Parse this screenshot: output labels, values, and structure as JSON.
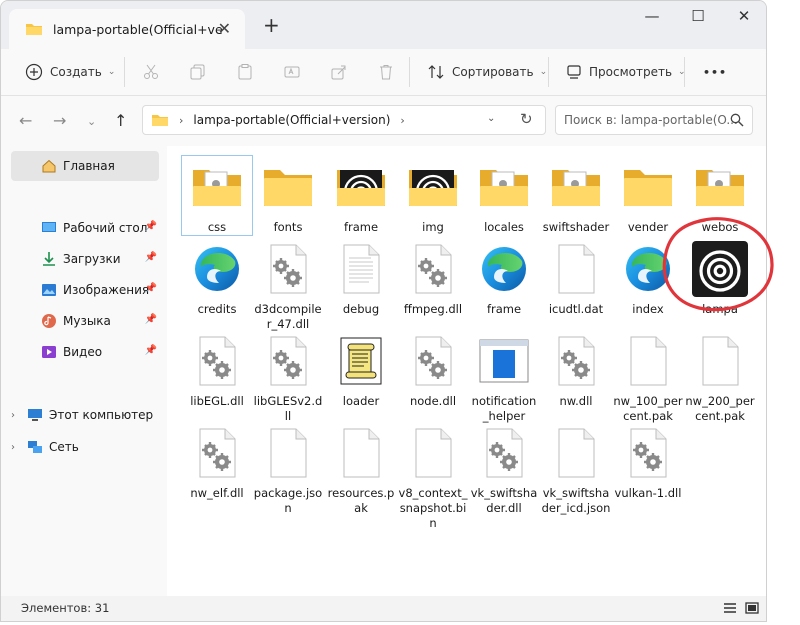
{
  "tab": {
    "title": "lampa-portable(Official+versi",
    "close": "✕",
    "new": "+"
  },
  "window_controls": {
    "minimize": "—",
    "maximize": "☐",
    "close": "✕"
  },
  "toolbar": {
    "create": "Создать",
    "sort": "Сортировать",
    "view": "Просмотреть",
    "more": "•••"
  },
  "address": {
    "crumb": "lampa-portable(Official+version)",
    "search_placeholder": "Поиск в: lampa-portable(O..."
  },
  "sidebar": {
    "home": "Главная",
    "pinned": [
      "Рабочий стол",
      "Загрузки",
      "Изображения",
      "Музыка",
      "Видео"
    ],
    "this_pc": "Этот компьютер",
    "network": "Сеть"
  },
  "files": [
    {
      "label": "css",
      "type": "folder-doc"
    },
    {
      "label": "fonts",
      "type": "folder"
    },
    {
      "label": "frame",
      "type": "folder-lampa"
    },
    {
      "label": "img",
      "type": "folder-lampa"
    },
    {
      "label": "locales",
      "type": "folder-doc"
    },
    {
      "label": "swiftshader",
      "type": "folder-doc"
    },
    {
      "label": "vender",
      "type": "folder"
    },
    {
      "label": "webos",
      "type": "folder-doc"
    },
    {
      "label": "credits",
      "type": "edge"
    },
    {
      "label": "d3dcompiler_47.dll",
      "type": "dll"
    },
    {
      "label": "debug",
      "type": "textdoc"
    },
    {
      "label": "ffmpeg.dll",
      "type": "dll"
    },
    {
      "label": "frame",
      "type": "edge"
    },
    {
      "label": "icudtl.dat",
      "type": "blank"
    },
    {
      "label": "index",
      "type": "edge"
    },
    {
      "label": "lampa",
      "type": "lampa-app"
    },
    {
      "label": "libEGL.dll",
      "type": "dll"
    },
    {
      "label": "libGLESv2.dll",
      "type": "dll"
    },
    {
      "label": "loader",
      "type": "script"
    },
    {
      "label": "node.dll",
      "type": "dll"
    },
    {
      "label": "notification_helper",
      "type": "exe"
    },
    {
      "label": "nw.dll",
      "type": "dll"
    },
    {
      "label": "nw_100_percent.pak",
      "type": "blank"
    },
    {
      "label": "nw_200_percent.pak",
      "type": "blank"
    },
    {
      "label": "nw_elf.dll",
      "type": "dll"
    },
    {
      "label": "package.json",
      "type": "blank"
    },
    {
      "label": "resources.pak",
      "type": "blank"
    },
    {
      "label": "v8_context_snapshot.bin",
      "type": "blank"
    },
    {
      "label": "vk_swiftshader.dll",
      "type": "dll"
    },
    {
      "label": "vk_swiftshader_icd.json",
      "type": "blank"
    },
    {
      "label": "vulkan-1.dll",
      "type": "dll"
    }
  ],
  "status": {
    "count_text": "Элементов: 31"
  },
  "colors": {
    "folder": "#f8c646",
    "folder_light": "#ffd867",
    "accent": "#0067c0",
    "annotation": "#e0353b"
  }
}
